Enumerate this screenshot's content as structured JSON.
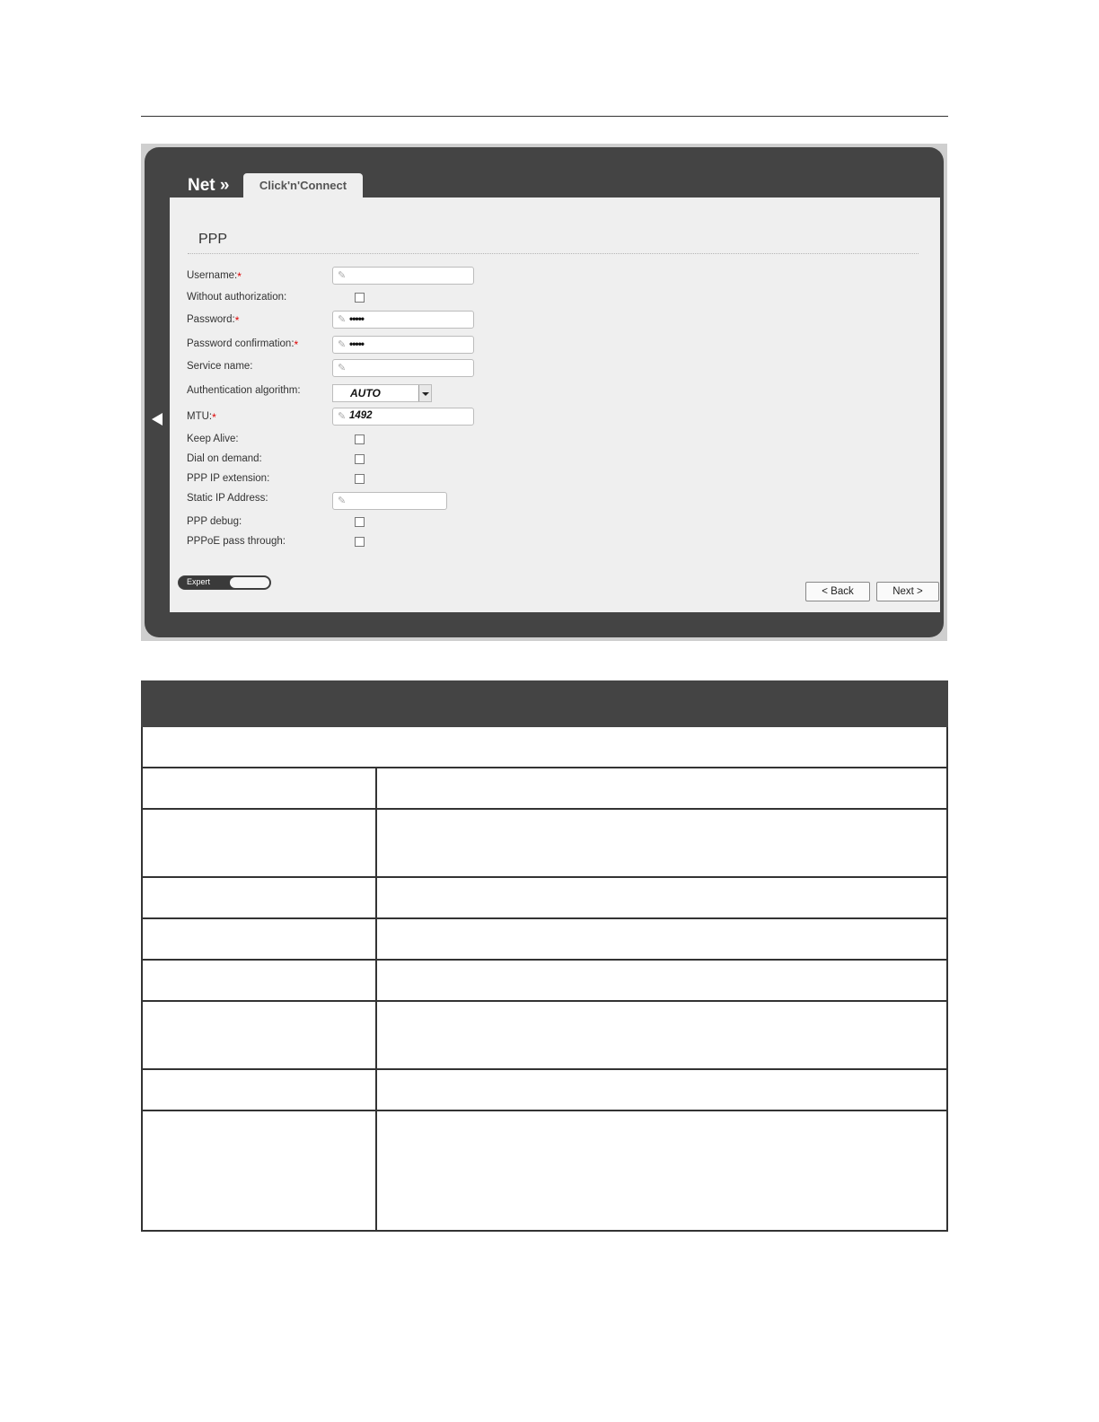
{
  "nav": {
    "title": "Net »",
    "tab": "Click'n'Connect"
  },
  "section": {
    "title": "PPP"
  },
  "form": {
    "username": {
      "label": "Username:",
      "required": "*",
      "value": ""
    },
    "without_auth": {
      "label": "Without authorization:",
      "checked": false
    },
    "password": {
      "label": "Password:",
      "required": "*",
      "value": "•••••"
    },
    "password_confirm": {
      "label": "Password confirmation:",
      "required": "*",
      "value": "•••••"
    },
    "service_name": {
      "label": "Service name:",
      "value": ""
    },
    "auth_algorithm": {
      "label": "Authentication algorithm:",
      "value": "AUTO"
    },
    "mtu": {
      "label": "MTU:",
      "required": "*",
      "value": "1492"
    },
    "keep_alive": {
      "label": "Keep Alive:",
      "checked": false
    },
    "dial_on_demand": {
      "label": "Dial on demand:",
      "checked": false
    },
    "ppp_ip_extension": {
      "label": "PPP IP extension:",
      "checked": false
    },
    "static_ip": {
      "label": "Static IP Address:",
      "value": ""
    },
    "ppp_debug": {
      "label": "PPP debug:",
      "checked": false
    },
    "pppoe_pass_through": {
      "label": "PPPoE pass through:",
      "checked": false
    }
  },
  "expert_toggle": {
    "label": "Expert"
  },
  "buttons": {
    "back": "< Back",
    "next": "Next >"
  },
  "colors": {
    "frame": "#444444",
    "content": "#efefef",
    "required": "#dd0000",
    "table_header": "#444444"
  }
}
